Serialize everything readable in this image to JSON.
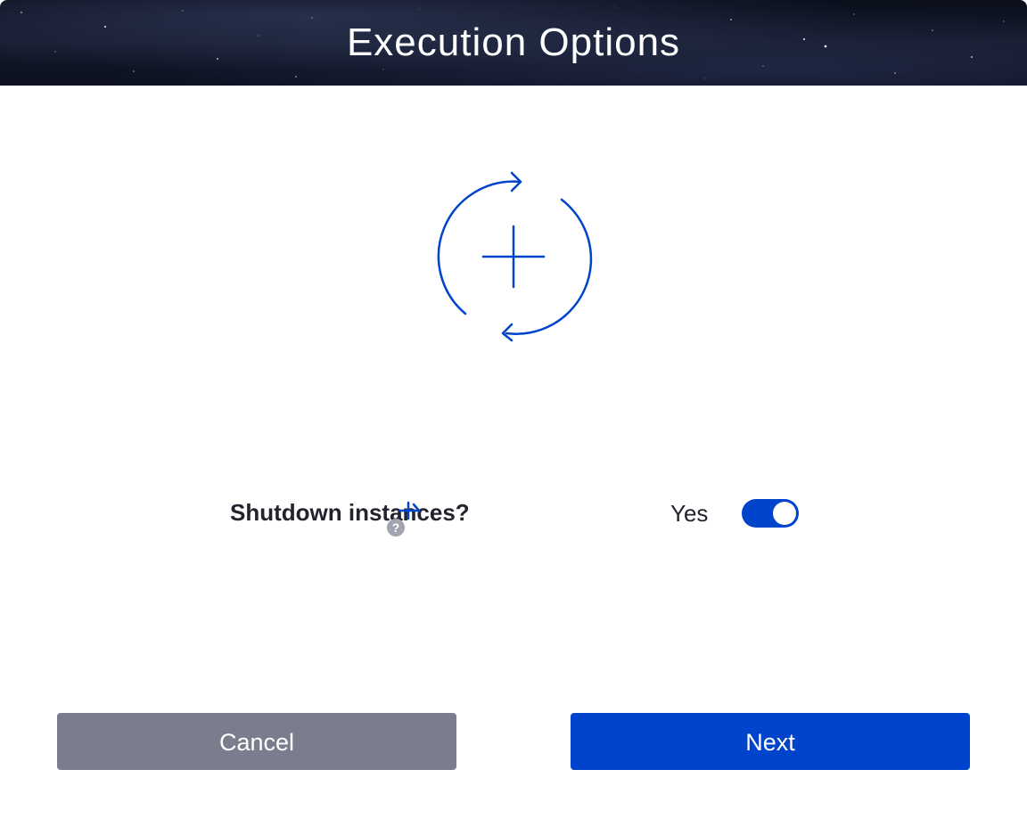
{
  "dialog": {
    "title": "Execution Options"
  },
  "hero": {
    "icon": "refresh-plus-icon",
    "color": "#0044cc"
  },
  "option": {
    "label": "Shutdown instances?",
    "required_icon": "required-asterisk-icon",
    "help_icon": "help-icon",
    "help_glyph": "?",
    "toggle_text": "Yes",
    "toggle_on": true
  },
  "buttons": {
    "cancel_label": "Cancel",
    "next_label": "Next"
  },
  "colors": {
    "accent": "#0044cc",
    "cancel_bg": "#7a7d8e",
    "text": "#22232e",
    "help_icon_bg": "#a2a5b1"
  }
}
